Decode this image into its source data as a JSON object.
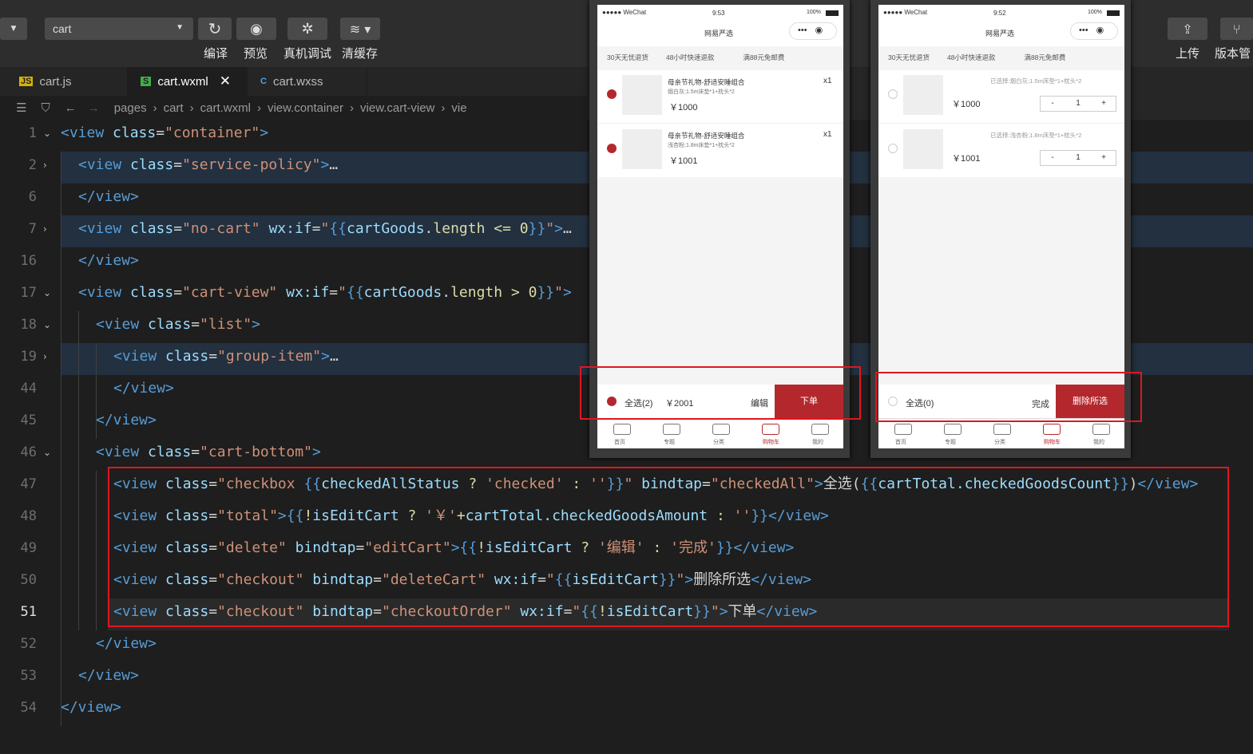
{
  "toolbar": {
    "compile_target": "cart",
    "compile": "编译",
    "preview": "预览",
    "remote_debug": "真机调试",
    "clear_cache": "清缓存",
    "upload": "上传",
    "version": "版本管"
  },
  "tabs": [
    {
      "icon": "JS",
      "label": "cart.js"
    },
    {
      "icon": "S",
      "label": "cart.wxml"
    },
    {
      "icon": "C",
      "label": "cart.wxss"
    }
  ],
  "breadcrumb": [
    "pages",
    "cart",
    "cart.wxml",
    "view.container",
    "view.cart-view",
    "vie"
  ],
  "lines": [
    {
      "n": "1",
      "fold": "v",
      "t": [
        [
          "tag",
          "<view "
        ],
        [
          "attr",
          "class"
        ],
        [
          "pu",
          "="
        ],
        [
          "str",
          "\"container\""
        ],
        [
          "tag",
          ">"
        ]
      ]
    },
    {
      "n": "2",
      "fold": ">",
      "hl": 1,
      "t": [
        [
          "tag",
          "<view "
        ],
        [
          "attr",
          "class"
        ],
        [
          "pu",
          "="
        ],
        [
          "str",
          "\"service-policy\""
        ],
        [
          "tag",
          ">"
        ],
        [
          "pu",
          "…"
        ]
      ]
    },
    {
      "n": "6",
      "t": [
        [
          "tag",
          "</view>"
        ]
      ]
    },
    {
      "n": "7",
      "fold": ">",
      "hl": 1,
      "t": [
        [
          "tag",
          "<view "
        ],
        [
          "attr",
          "class"
        ],
        [
          "pu",
          "="
        ],
        [
          "str",
          "\"no-cart\" "
        ],
        [
          "attr",
          "wx:if"
        ],
        [
          "pu",
          "="
        ],
        [
          "str",
          "\""
        ],
        [
          "tag",
          "{{"
        ],
        [
          "attr",
          "cartGoods"
        ],
        [
          "pu",
          "."
        ],
        [
          "ex",
          "length"
        ],
        [
          "pu",
          " "
        ],
        [
          "ex",
          "<="
        ],
        [
          "pu",
          " "
        ],
        [
          "ex",
          "0"
        ],
        [
          "tag",
          "}}"
        ],
        [
          "str",
          "\""
        ],
        [
          "tag",
          ">"
        ],
        [
          "pu",
          "…"
        ]
      ]
    },
    {
      "n": "16",
      "t": [
        [
          "tag",
          "</view>"
        ]
      ]
    },
    {
      "n": "17",
      "fold": "v",
      "t": [
        [
          "tag",
          "<view "
        ],
        [
          "attr",
          "class"
        ],
        [
          "pu",
          "="
        ],
        [
          "str",
          "\"cart-view\" "
        ],
        [
          "attr",
          "wx:if"
        ],
        [
          "pu",
          "="
        ],
        [
          "str",
          "\""
        ],
        [
          "tag",
          "{{"
        ],
        [
          "attr",
          "cartGoods"
        ],
        [
          "pu",
          "."
        ],
        [
          "ex",
          "length"
        ],
        [
          "pu",
          " "
        ],
        [
          "ex",
          ">"
        ],
        [
          "pu",
          " "
        ],
        [
          "ex",
          "0"
        ],
        [
          "tag",
          "}}"
        ],
        [
          "str",
          "\""
        ],
        [
          "tag",
          ">"
        ]
      ]
    },
    {
      "n": "18",
      "fold": "v",
      "t": [
        [
          "tag",
          "<view "
        ],
        [
          "attr",
          "class"
        ],
        [
          "pu",
          "="
        ],
        [
          "str",
          "\"list\""
        ],
        [
          "tag",
          ">"
        ]
      ]
    },
    {
      "n": "19",
      "fold": ">",
      "hl": 1,
      "t": [
        [
          "tag",
          "<view "
        ],
        [
          "attr",
          "class"
        ],
        [
          "pu",
          "="
        ],
        [
          "str",
          "\"group-item\""
        ],
        [
          "tag",
          ">"
        ],
        [
          "pu",
          "…"
        ]
      ]
    },
    {
      "n": "44",
      "t": [
        [
          "tag",
          "</view>"
        ]
      ]
    },
    {
      "n": "45",
      "t": [
        [
          "tag",
          "</view>"
        ]
      ]
    },
    {
      "n": "46",
      "fold": "v",
      "t": [
        [
          "tag",
          "<view "
        ],
        [
          "attr",
          "class"
        ],
        [
          "pu",
          "="
        ],
        [
          "str",
          "\"cart-bottom\""
        ],
        [
          "tag",
          ">"
        ]
      ]
    },
    {
      "n": "47",
      "t": [
        [
          "tag",
          "<view "
        ],
        [
          "attr",
          "class"
        ],
        [
          "pu",
          "="
        ],
        [
          "str",
          "\"checkbox "
        ],
        [
          "tag",
          "{{"
        ],
        [
          "attr",
          "checkedAllStatus"
        ],
        [
          "ex",
          " ? "
        ],
        [
          "str",
          "'checked'"
        ],
        [
          "ex",
          " : "
        ],
        [
          "str",
          "''"
        ],
        [
          "tag",
          "}}"
        ],
        [
          "str",
          "\" "
        ],
        [
          "attr",
          "bindtap"
        ],
        [
          "pu",
          "="
        ],
        [
          "str",
          "\"checkedAll\""
        ],
        [
          "tag",
          ">"
        ],
        [
          "pu",
          "全选("
        ],
        [
          "tag",
          "{{"
        ],
        [
          "attr",
          "cartTotal.checkedGoodsCount"
        ],
        [
          "tag",
          "}}"
        ],
        [
          "pu",
          ")"
        ],
        [
          "tag",
          "</view>"
        ]
      ]
    },
    {
      "n": "48",
      "t": [
        [
          "tag",
          "<view "
        ],
        [
          "attr",
          "class"
        ],
        [
          "pu",
          "="
        ],
        [
          "str",
          "\"total\""
        ],
        [
          "tag",
          ">{{"
        ],
        [
          "ex",
          "!"
        ],
        [
          "attr",
          "isEditCart"
        ],
        [
          "ex",
          " ? "
        ],
        [
          "str",
          "'￥'"
        ],
        [
          "ex",
          "+"
        ],
        [
          "attr",
          "cartTotal.checkedGoodsAmount"
        ],
        [
          "ex",
          " : "
        ],
        [
          "str",
          "''"
        ],
        [
          "tag",
          "}}</view>"
        ]
      ]
    },
    {
      "n": "49",
      "t": [
        [
          "tag",
          "<view "
        ],
        [
          "attr",
          "class"
        ],
        [
          "pu",
          "="
        ],
        [
          "str",
          "\"delete\" "
        ],
        [
          "attr",
          "bindtap"
        ],
        [
          "pu",
          "="
        ],
        [
          "str",
          "\"editCart\""
        ],
        [
          "tag",
          ">{{"
        ],
        [
          "ex",
          "!"
        ],
        [
          "attr",
          "isEditCart"
        ],
        [
          "ex",
          " ? "
        ],
        [
          "str",
          "'编辑'"
        ],
        [
          "ex",
          " : "
        ],
        [
          "str",
          "'完成'"
        ],
        [
          "tag",
          "}}</view>"
        ]
      ]
    },
    {
      "n": "50",
      "t": [
        [
          "tag",
          "<view "
        ],
        [
          "attr",
          "class"
        ],
        [
          "pu",
          "="
        ],
        [
          "str",
          "\"checkout\" "
        ],
        [
          "attr",
          "bindtap"
        ],
        [
          "pu",
          "="
        ],
        [
          "str",
          "\"deleteCart\" "
        ],
        [
          "attr",
          "wx:if"
        ],
        [
          "pu",
          "="
        ],
        [
          "str",
          "\""
        ],
        [
          "tag",
          "{{"
        ],
        [
          "attr",
          "isEditCart"
        ],
        [
          "tag",
          "}}"
        ],
        [
          "str",
          "\""
        ],
        [
          "tag",
          ">"
        ],
        [
          "pu",
          "删除所选"
        ],
        [
          "tag",
          "</view>"
        ]
      ]
    },
    {
      "n": "51",
      "hl": 2,
      "t": [
        [
          "tag",
          "<view "
        ],
        [
          "attr",
          "class"
        ],
        [
          "pu",
          "="
        ],
        [
          "str",
          "\"checkout\" "
        ],
        [
          "attr",
          "bindtap"
        ],
        [
          "pu",
          "="
        ],
        [
          "str",
          "\"checkoutOrder\" "
        ],
        [
          "attr",
          "wx:if"
        ],
        [
          "pu",
          "="
        ],
        [
          "str",
          "\""
        ],
        [
          "tag",
          "{{"
        ],
        [
          "ex",
          "!"
        ],
        [
          "attr",
          "isEditCart"
        ],
        [
          "tag",
          "}}"
        ],
        [
          "str",
          "\""
        ],
        [
          "tag",
          ">"
        ],
        [
          "pu",
          "下单"
        ],
        [
          "tag",
          "</view>"
        ]
      ]
    },
    {
      "n": "52",
      "t": [
        [
          "tag",
          "</view>"
        ]
      ]
    },
    {
      "n": "53",
      "t": [
        [
          "tag",
          "</view>"
        ]
      ]
    },
    {
      "n": "54",
      "t": [
        [
          "tag",
          "</view>"
        ]
      ]
    }
  ],
  "phone1": {
    "carrier": "●●●●● WeChat",
    "time": "9:53",
    "battery": "100%",
    "title": "网易严选",
    "policies": [
      "30天无忧退货",
      "48小时快速退款",
      "满88元免邮费"
    ],
    "items": [
      {
        "name": "母亲节礼物-舒适安睡组合",
        "spec": "烟白灰;1.5m床垫*1+枕头*2",
        "price": "￥1000",
        "qty": "x1"
      },
      {
        "name": "母亲节礼物-舒适安睡组合",
        "spec": "浅杏粉;1.8m床垫*1+枕头*2",
        "price": "￥1001",
        "qty": "x1"
      }
    ],
    "select_all": "全选(2)",
    "total": "￥2001",
    "edit": "编辑",
    "checkout": "下单"
  },
  "phone2": {
    "carrier": "●●●●● WeChat",
    "time": "9:52",
    "battery": "100%",
    "title": "网易严选",
    "policies": [
      "30天无忧退货",
      "48小时快速退款",
      "满88元免邮费"
    ],
    "items": [
      {
        "selected": "已选择:烟白灰;1.5m床垫*1+枕头*2",
        "price": "￥1000",
        "minus": "-",
        "num": "1",
        "plus": "+"
      },
      {
        "selected": "已选择:浅杏粉;1.8m床垫*1+枕头*2",
        "price": "￥1001",
        "minus": "-",
        "num": "1",
        "plus": "+"
      }
    ],
    "select_all": "全选(0)",
    "edit": "完成",
    "checkout": "删除所选"
  },
  "nav": [
    "首页",
    "专题",
    "分类",
    "购物车",
    "我的"
  ]
}
